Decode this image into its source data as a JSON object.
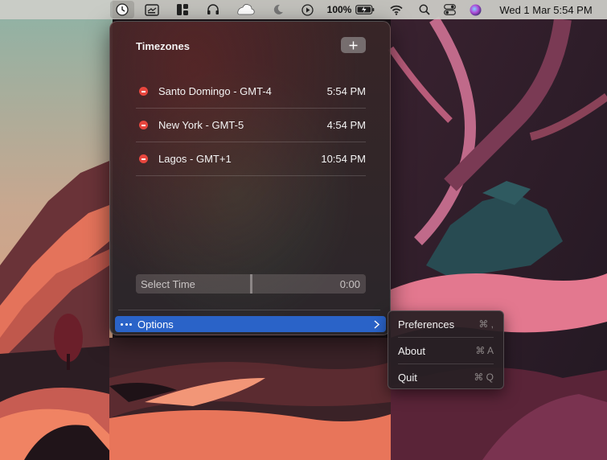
{
  "menubar": {
    "battery_percent": "100%",
    "clock": "Wed 1 Mar  5:54 PM",
    "icons": [
      "timezones-app-icon",
      "screen-share-icon",
      "window-layout-icon",
      "headphones-icon",
      "cloud-icon",
      "moon-icon",
      "play-icon",
      "battery-icon",
      "wifi-icon",
      "spotlight-search-icon",
      "control-center-icon",
      "siri-icon"
    ]
  },
  "popover": {
    "title": "Timezones",
    "add_label": "+",
    "timezones": [
      {
        "name": "Santo Domingo - GMT-4",
        "time": "5:54 PM"
      },
      {
        "name": "New York - GMT-5",
        "time": "4:54 PM"
      },
      {
        "name": "Lagos - GMT+1",
        "time": "10:54 PM"
      }
    ],
    "select_time": {
      "label": "Select Time",
      "value": "0:00"
    },
    "options_label": "Options"
  },
  "submenu": {
    "items": [
      {
        "label": "Preferences",
        "shortcut": "⌘ ,"
      },
      {
        "label": "About",
        "shortcut": "⌘ A"
      },
      {
        "label": "Quit",
        "shortcut": "⌘ Q"
      }
    ]
  },
  "colors": {
    "accent": "#2a63c8",
    "remove": "#e8463e",
    "menubar_bg": "#cdcdc8"
  }
}
